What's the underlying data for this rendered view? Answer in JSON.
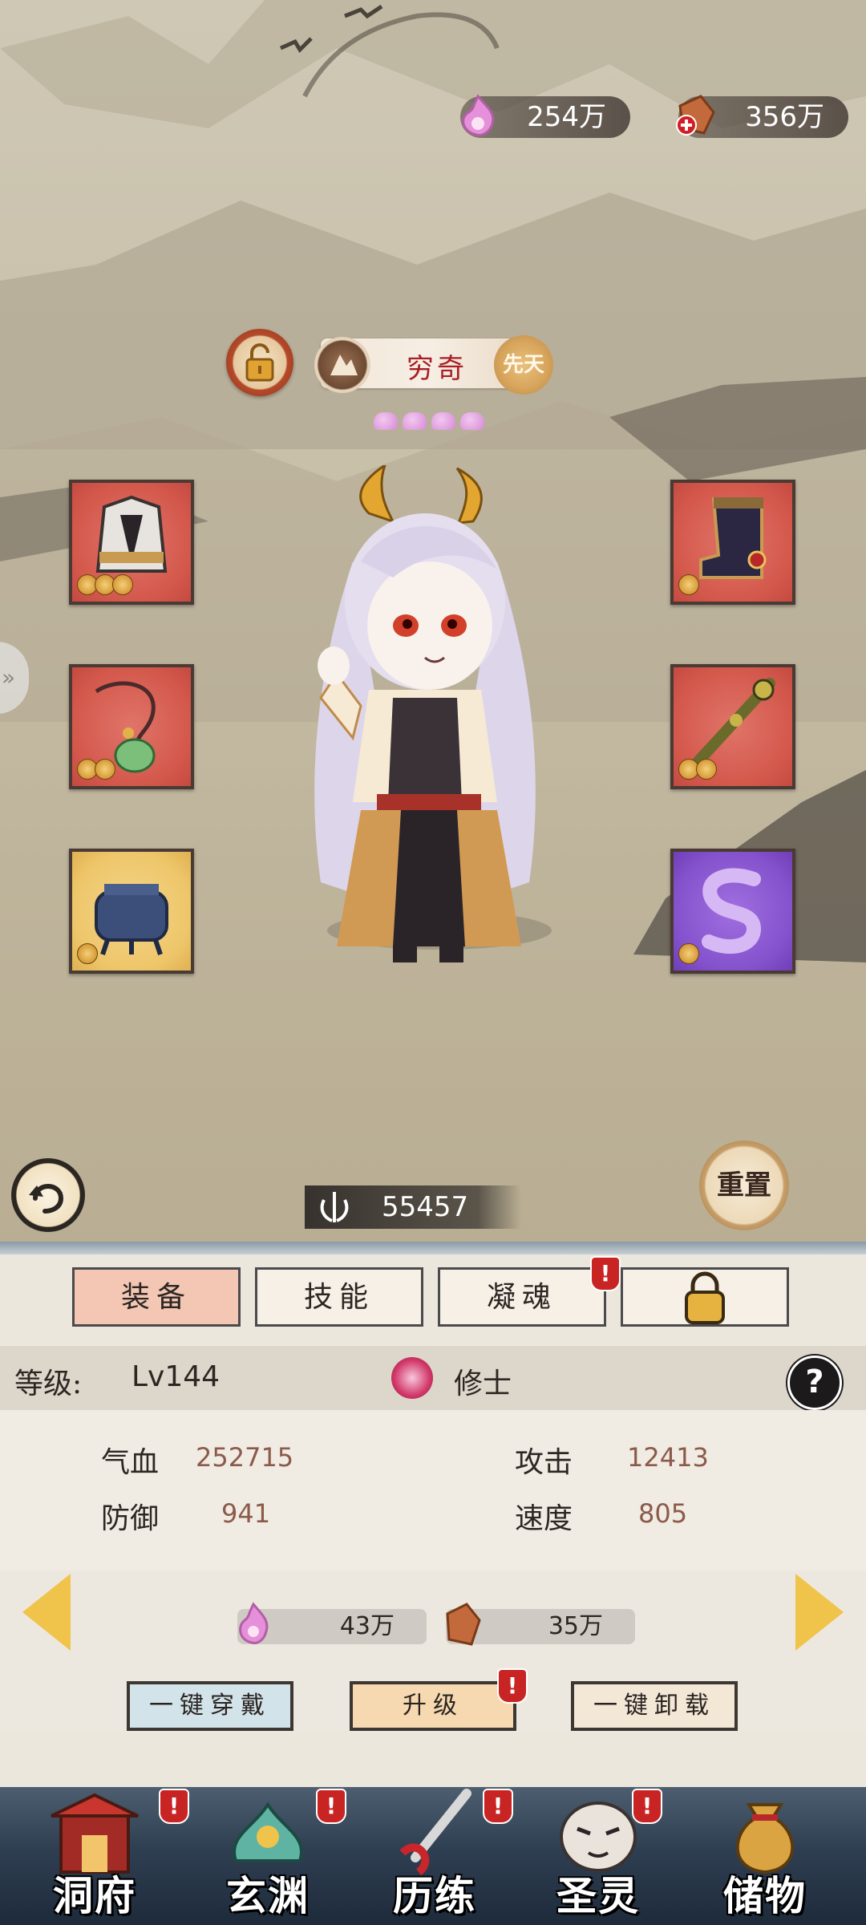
{
  "currency": {
    "spirit_amount": "254万",
    "crystal_amount": "356万"
  },
  "character": {
    "name": "穷奇",
    "innate_badge": "先天",
    "star_pips": 4
  },
  "equipment_slots": [
    {
      "item": "armor",
      "rarity": "red",
      "coins": 3
    },
    {
      "item": "boots",
      "rarity": "red",
      "coins": 1
    },
    {
      "item": "jade-pendant",
      "rarity": "red",
      "coins": 2
    },
    {
      "item": "scepter",
      "rarity": "red",
      "coins": 2
    },
    {
      "item": "bronze-cauldron",
      "rarity": "gold",
      "coins": 1
    },
    {
      "item": "purple-dragon",
      "rarity": "purple",
      "coins": 1
    }
  ],
  "power": "55457",
  "reset_label": "重置",
  "tabs": [
    {
      "label": "装备",
      "active": true,
      "badge": ""
    },
    {
      "label": "技能",
      "active": false,
      "badge": ""
    },
    {
      "label": "凝魂",
      "active": false,
      "badge": "!"
    },
    {
      "label": "",
      "active": false,
      "badge": "",
      "icon": "lock-icon"
    }
  ],
  "level": {
    "label": "等级:",
    "value": "Lv144",
    "rank": "修士"
  },
  "stats": [
    {
      "label": "气血",
      "value": "252715"
    },
    {
      "label": "攻击",
      "value": "12413"
    },
    {
      "label": "防御",
      "value": "941"
    },
    {
      "label": "速度",
      "value": "805"
    }
  ],
  "costs": {
    "spirit_cost": "43万",
    "crystal_cost": "35万"
  },
  "actions": {
    "equip_all": "一键穿戴",
    "upgrade": "升级",
    "unequip_all": "一键卸载"
  },
  "nav": [
    {
      "label": "洞府",
      "badge": "!"
    },
    {
      "label": "玄渊",
      "badge": "!"
    },
    {
      "label": "历练",
      "badge": "!"
    },
    {
      "label": "圣灵",
      "badge": "!"
    },
    {
      "label": "储物",
      "badge": ""
    }
  ],
  "colors": {
    "tab_active": "#f4c6b4",
    "upgrade_button": "#f6d9b0",
    "equip_button": "#d3e3ea",
    "badge_red": "#c92424",
    "arrow_gold": "#f0c34a"
  }
}
